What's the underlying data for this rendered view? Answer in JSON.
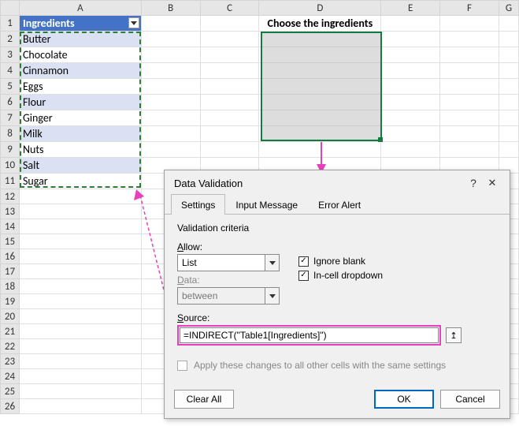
{
  "spreadsheet": {
    "columns": [
      "A",
      "B",
      "C",
      "D",
      "E",
      "F",
      "G"
    ],
    "row_count": 26,
    "table_header": "Ingredients",
    "ingredients": [
      "Butter",
      "Chocolate",
      "Cinnamon",
      "Eggs",
      "Flour",
      "Ginger",
      "Milk",
      "Nuts",
      "Salt",
      "Sugar"
    ],
    "title_d": "Choose the ingredients"
  },
  "dialog": {
    "title": "Data Validation",
    "help_glyph": "?",
    "close_glyph": "✕",
    "tabs": {
      "settings": "Settings",
      "input_message": "Input Message",
      "error_alert": "Error Alert"
    },
    "criteria_label": "Validation criteria",
    "allow": {
      "label_pre": "A",
      "label_post": "llow:",
      "value": "List"
    },
    "data": {
      "label_pre": "D",
      "label_post": "ata:",
      "value": "between"
    },
    "ignore_blank": {
      "label_pre": "Ignore ",
      "label_u": "b",
      "label_post": "lank",
      "checked": true
    },
    "incell": {
      "label_pre": "I",
      "label_post": "n-cell dropdown",
      "checked": true
    },
    "source": {
      "label_pre": "S",
      "label_post": "ource:",
      "value": "=INDIRECT(\"Table1[Ingredients]\")",
      "ref_glyph": "↥"
    },
    "apply": {
      "label_pre": "Apply these changes to all other cells with the same settings",
      "checked": false
    },
    "buttons": {
      "clear_all_pre": "C",
      "clear_all_post": "lear All",
      "ok": "OK",
      "cancel": "Cancel"
    }
  }
}
